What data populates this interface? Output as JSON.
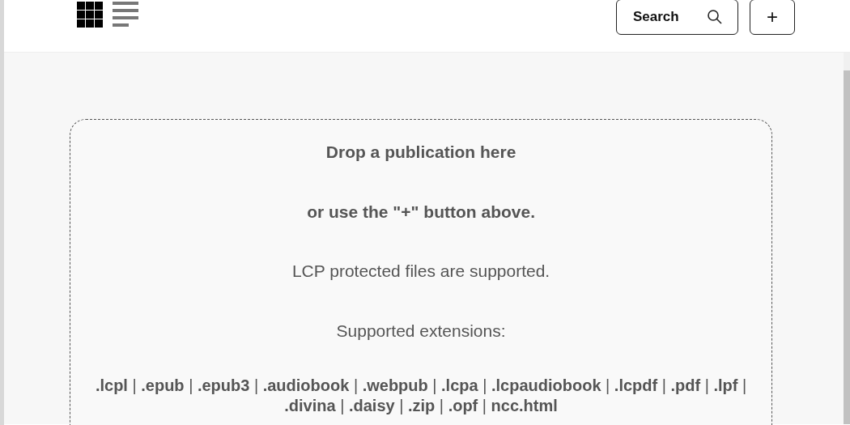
{
  "toolbar": {
    "views": [
      {
        "kind": "grid",
        "selected": true
      },
      {
        "kind": "list",
        "selected": false
      }
    ],
    "search_button": {
      "label": "Search"
    },
    "add_button": {
      "label": "+"
    }
  },
  "drop_zone": {
    "title": "Drop a publication here",
    "subtitle": "or use the \"+\" button above.",
    "lcp_note": "LCP protected files are supported.",
    "extensions_label": "Supported extensions:",
    "extensions": "**.lcpl** | **.epub** | **.epub3** | **.audiobook** | **.webpub** | **.lcpa** | **.lcpaudiobook** | **.lcpdf** | **.pdf** | **.lpf** | **.divina** | **.daisy** | **.zip** | **.opf** | **ncc.html**"
  }
}
